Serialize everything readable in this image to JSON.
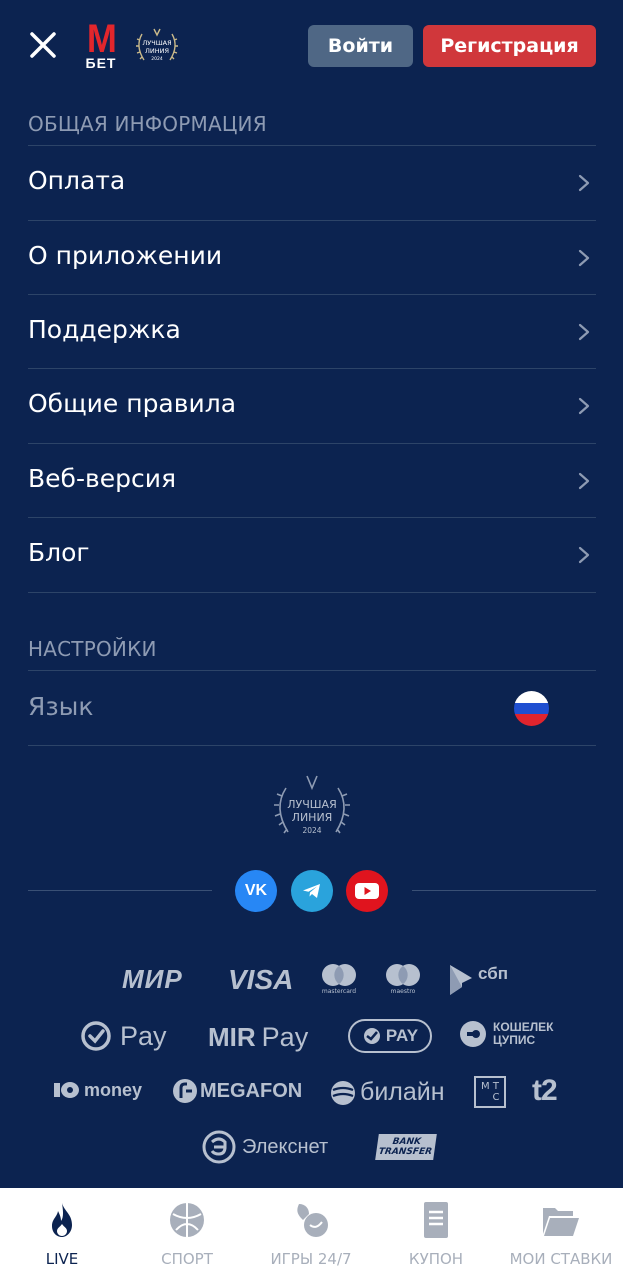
{
  "header": {
    "logo_top": "М",
    "logo_bottom": "БЕТ",
    "award_line1": "ЛУЧШАЯ",
    "award_line2": "ЛИНИЯ",
    "award_year": "2024",
    "login_label": "Войти",
    "register_label": "Регистрация"
  },
  "general_info": {
    "title": "ОБЩАЯ ИНФОРМАЦИЯ",
    "items": [
      {
        "label": "Оплата"
      },
      {
        "label": "О приложении"
      },
      {
        "label": "Поддержка"
      },
      {
        "label": "Общие правила"
      },
      {
        "label": "Веб-версия"
      },
      {
        "label": "Блог"
      }
    ]
  },
  "settings": {
    "title": "НАСТРОЙКИ",
    "language_label": "Язык",
    "language_flag": "russia-flag-icon"
  },
  "footer": {
    "award_line1": "ЛУЧШАЯ",
    "award_line2": "ЛИНИЯ",
    "award_year": "2024",
    "social": [
      {
        "name": "vk-icon",
        "label": "VK",
        "color": "#2787f5"
      },
      {
        "name": "telegram-icon",
        "color": "#2aa3dc"
      },
      {
        "name": "youtube-icon",
        "color": "#e0141e"
      }
    ],
    "payments": {
      "mir": "МИР",
      "visa": "VISA",
      "mastercard": "mastercard",
      "maestro": "maestro",
      "sbp": "сбп",
      "gpay": "Pay",
      "mirpay_a": "MIR",
      "mirpay_b": "Pay",
      "sberpay": "PAY",
      "koshelek_1": "КОШЕЛЕК",
      "koshelek_2": "ЦУПИС",
      "yoomoney": "money",
      "megafon": "MEGAFON",
      "beeline": "билайн",
      "mts_1": "М Т",
      "mts_2": "С",
      "t2": "t2",
      "elecsnet": "Элекснет",
      "bank_1": "BANK",
      "bank_2": "TRANSFER"
    }
  },
  "bottom_nav": [
    {
      "label": "LIVE",
      "icon": "fire-icon",
      "active": true
    },
    {
      "label": "СПОРТ",
      "icon": "ball-icon",
      "active": false
    },
    {
      "label": "ИГРЫ 24/7",
      "icon": "games-icon",
      "active": false
    },
    {
      "label": "КУПОН",
      "icon": "coupon-icon",
      "active": false
    },
    {
      "label": "МОИ СТАВКИ",
      "icon": "folder-icon",
      "active": false
    }
  ],
  "colors": {
    "background": "#0c2350",
    "login_button": "#4f6785",
    "register_button": "#d0373b",
    "muted_text": "#8e9bb3"
  }
}
